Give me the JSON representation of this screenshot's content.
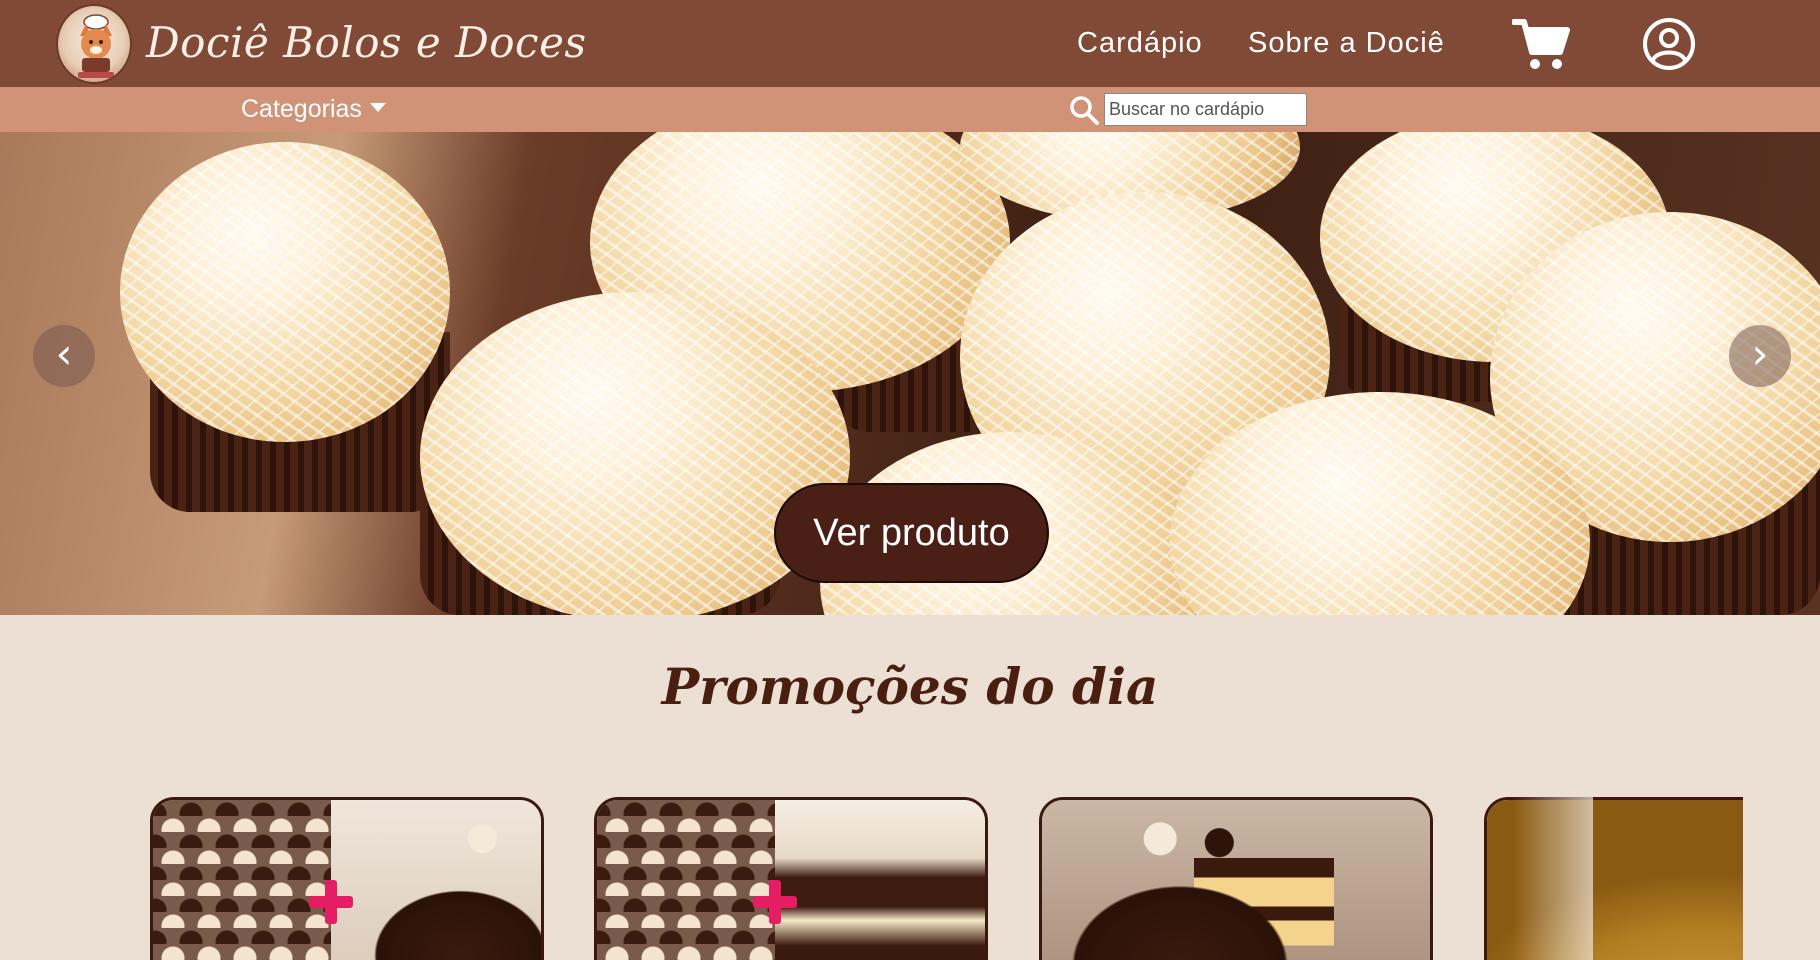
{
  "header": {
    "brand_name": "Dociê Bolos e Doces",
    "nav": {
      "cardapio_label": "Cardápio",
      "sobre_label": "Sobre a Dociê"
    },
    "icons": {
      "logo": "bakery-fox-logo-icon",
      "cart": "cart-icon",
      "account": "user-circle-icon"
    }
  },
  "subbar": {
    "categories_label": "Categorias",
    "search": {
      "placeholder": "Buscar no cardápio",
      "value": "",
      "icon": "search-icon"
    }
  },
  "hero": {
    "cta_label": "Ver produto",
    "prev_icon": "chevron-left-icon",
    "next_icon": "chevron-right-icon",
    "prev_glyph": "‹",
    "next_glyph": "›"
  },
  "promotions": {
    "title": "Promoções do dia",
    "cards": [
      {
        "image": "brigadeiros-tray-plus-chocolate-cake"
      },
      {
        "image": "brigadeiros-tray-plus-pudding-cup"
      },
      {
        "image": "chocolate-layer-cake"
      },
      {
        "image": "caramel-cake"
      }
    ]
  },
  "colors": {
    "header_bg": "#814a37",
    "subbar_bg": "#d19378",
    "page_bg": "#ebe0d3",
    "cta_bg": "#4a1f16",
    "title_color": "#4b1e12",
    "plus_accent": "#e51e63"
  }
}
